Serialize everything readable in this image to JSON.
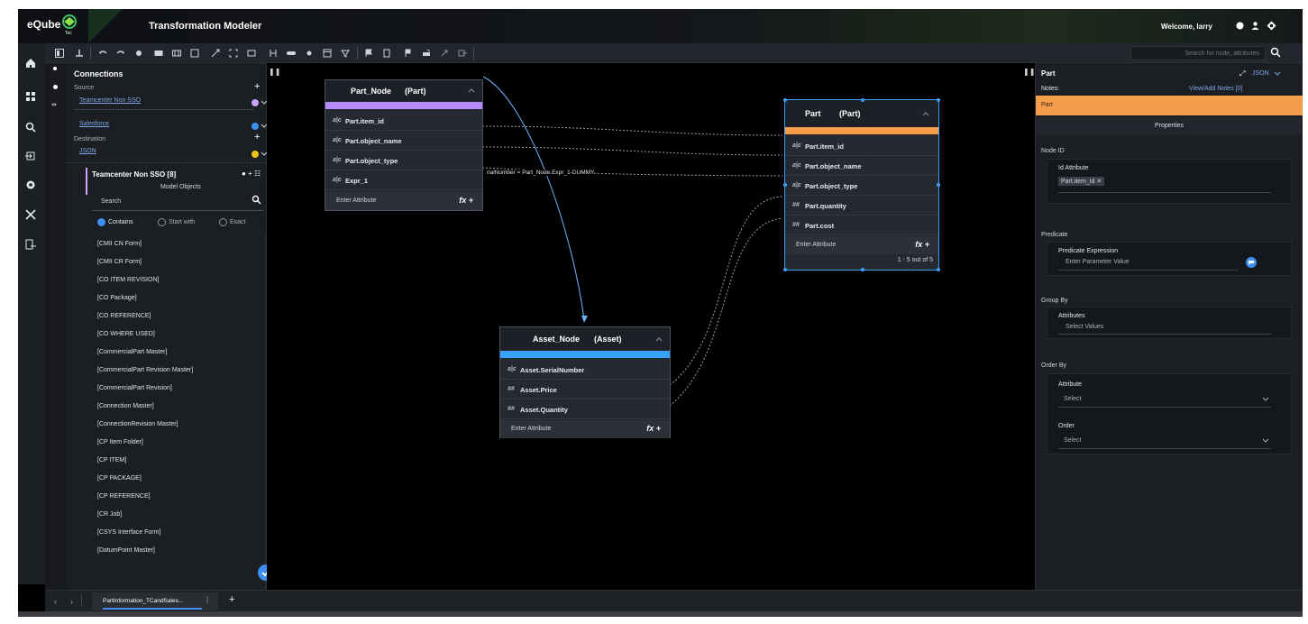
{
  "app": {
    "logo": "eQube",
    "logo_sub": "Tec",
    "title": "Transformation Modeler",
    "welcome": "Welcome, larry"
  },
  "toolbar": {
    "search_placeholder": "Search for node, attributes"
  },
  "connections": {
    "title": "Connections",
    "source_label": "Source",
    "sources": [
      "Teamcenter Non SSO",
      "Salesforce"
    ],
    "destination_label": "Destination",
    "destination": "JSON",
    "colors": {
      "teamcenter": "#c9a4ff",
      "salesforce": "#3c8ff0",
      "json": "#f2c21a"
    }
  },
  "model_objects": {
    "header": "Teamcenter Non SSO [8]",
    "subtitle": "Model Objects",
    "search_placeholder": "Search",
    "filters": [
      "Contains",
      "Start with",
      "Exact"
    ],
    "selected_filter": "Contains",
    "items": [
      "[CMII CN Form]",
      "[CMII CR Form]",
      "[CO ITEM REVISION]",
      "[CO Package]",
      "[CO REFERENCE]",
      "[CO WHERE USED]",
      "[CommercialPart Master]",
      "[CommercialPart Revision Master]",
      "[CommercialPart Revision]",
      "[Connection Master]",
      "[ConnectionRevision Master]",
      "[CP Item Folder]",
      "[CP ITEM]",
      "[CP PACKAGE]",
      "[CP REFERENCE]",
      "[CR Job]",
      "[CSYS Interface Form]",
      "[DatumPoint Master]"
    ]
  },
  "nodes": {
    "part_node": {
      "name": "Part_Node",
      "type": "(Part)",
      "bar_color": "#b58cff",
      "rows": [
        {
          "icon": "a|c",
          "label": "Part.item_id"
        },
        {
          "icon": "a|c",
          "label": "Part.object_name"
        },
        {
          "icon": "a|c",
          "label": "Part.object_type"
        },
        {
          "icon": "a|c",
          "label": "Expr_1"
        }
      ],
      "enter": "Enter Attribute",
      "fx": "fx +"
    },
    "part": {
      "name": "Part",
      "type": "(Part)",
      "bar_color": "#f59d4a",
      "rows": [
        {
          "icon": "a|c",
          "label": "Part.item_id"
        },
        {
          "icon": "a|c",
          "label": "Part.object_name"
        },
        {
          "icon": "a|c",
          "label": "Part.object_type"
        },
        {
          "icon": "##",
          "label": "Part.quantity"
        },
        {
          "icon": "##",
          "label": "Part.cost"
        }
      ],
      "enter": "Enter Attribute",
      "fx": "fx +",
      "count": "1 - 5 out of 5"
    },
    "asset_node": {
      "name": "Asset_Node",
      "type": "(Asset)",
      "bar_color": "#39a1ff",
      "rows": [
        {
          "icon": "a|c",
          "label": "Asset.SerialNumber"
        },
        {
          "icon": "##",
          "label": "Asset.Price"
        },
        {
          "icon": "##",
          "label": "Asset.Quantity"
        }
      ],
      "enter": "Enter Attribute",
      "fx": "fx +"
    }
  },
  "join_label": "rialNumber = Part_Node.Expr_1-DUMMY",
  "properties": {
    "title": "Part",
    "format": "JSON",
    "notes_label": "Notes:",
    "notes_link": "View/Add Notes [0]",
    "node_name": "Part",
    "section": "Properties",
    "node_id_label": "Node ID",
    "id_attribute_label": "Id Attribute",
    "id_attribute_value": "Part.item_id",
    "predicate_label": "Predicate",
    "predicate_expr_label": "Predicate Expression",
    "predicate_placeholder": "Enter Parameter Value",
    "group_by_label": "Group By",
    "attributes_label": "Attributes",
    "attributes_placeholder": "Select Values",
    "order_by_label": "Order By",
    "attribute_label": "Attribute",
    "attribute_value": "Select",
    "order_label": "Order",
    "order_value": "Select",
    "accent": "#f59d4a"
  },
  "tabs": {
    "active": "PartInformation_TCandSales..."
  }
}
